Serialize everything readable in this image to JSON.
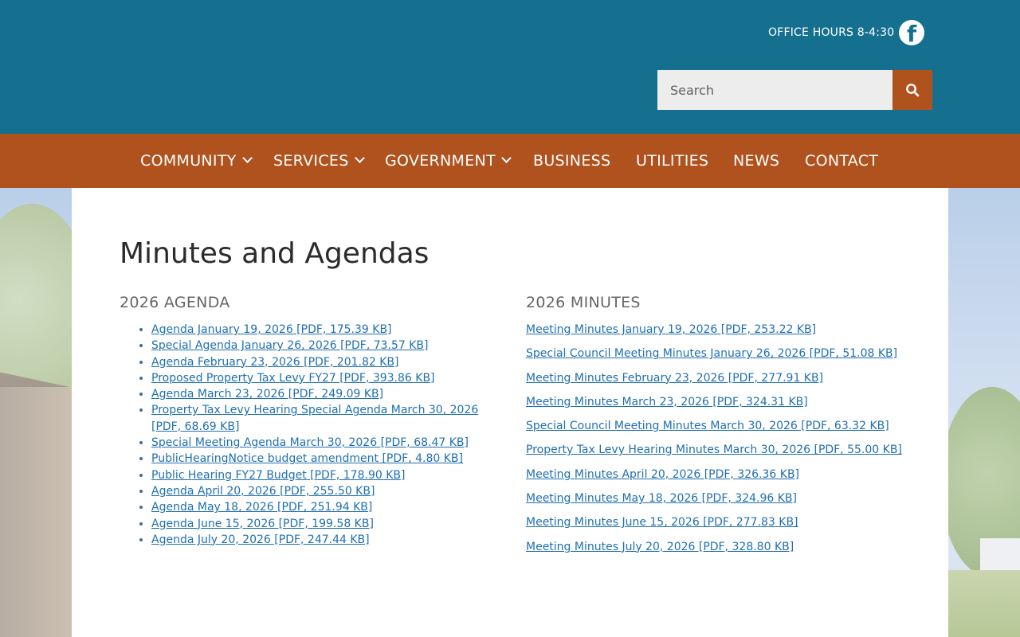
{
  "header": {
    "office_hours": "OFFICE HOURS 8-4:30",
    "facebook_icon": "facebook-icon",
    "search": {
      "placeholder": "Search",
      "value": "",
      "button_icon": "search-icon"
    }
  },
  "colors": {
    "header_bg": "#157090",
    "nav_bg": "#b0521e",
    "link": "#1f6fb0"
  },
  "nav": {
    "items": [
      {
        "label": "COMMUNITY",
        "dropdown": true
      },
      {
        "label": "SERVICES",
        "dropdown": true
      },
      {
        "label": "GOVERNMENT",
        "dropdown": true
      },
      {
        "label": "BUSINESS",
        "dropdown": false
      },
      {
        "label": "UTILITIES",
        "dropdown": false
      },
      {
        "label": "NEWS",
        "dropdown": false
      },
      {
        "label": "CONTACT",
        "dropdown": false
      }
    ]
  },
  "main": {
    "title": "Minutes and Agendas",
    "agenda": {
      "heading": "2026 AGENDA",
      "items": [
        "Agenda January 19, 2026 [PDF, 175.39 KB]",
        "Special Agenda January 26, 2026 [PDF, 73.57 KB]",
        "Agenda February 23, 2026 [PDF, 201.82 KB]",
        "Proposed Property Tax Levy FY27 [PDF, 393.86 KB]",
        "Agenda March 23, 2026 [PDF, 249.09 KB]",
        "Property Tax Levy Hearing Special Agenda March 30, 2026 [PDF, 68.69 KB]",
        "Special Meeting Agenda March 30, 2026 [PDF, 68.47 KB]",
        "PublicHearingNotice budget amendment [PDF, 4.80 KB]",
        "Public Hearing FY27 Budget [PDF, 178.90 KB]",
        "Agenda April 20, 2026 [PDF, 255.50 KB]",
        "Agenda May 18, 2026 [PDF, 251.94 KB]",
        "Agenda June 15, 2026 [PDF, 199.58 KB]",
        "Agenda July 20, 2026 [PDF, 247.44 KB]"
      ]
    },
    "minutes": {
      "heading": "2026 MINUTES",
      "items": [
        "Meeting Minutes January 19, 2026 [PDF, 253.22 KB]",
        "Special Council Meeting Minutes January 26, 2026 [PDF, 51.08 KB]",
        "Meeting Minutes February 23, 2026 [PDF, 277.91 KB]",
        "Meeting Minutes March 23, 2026 [PDF, 324.31 KB]",
        "Special Council Meeting Minutes March 30, 2026 [PDF, 63.32 KB]",
        "Property Tax Levy Hearing Minutes March 30, 2026 [PDF, 55.00 KB]",
        "Meeting Minutes April 20, 2026 [PDF, 326.36 KB]",
        "Meeting Minutes May 18, 2026 [PDF, 324.96 KB]",
        "Meeting Minutes June 15, 2026 [PDF, 277.83 KB]",
        "Meeting Minutes July 20, 2026 [PDF, 328.80 KB]"
      ]
    }
  }
}
